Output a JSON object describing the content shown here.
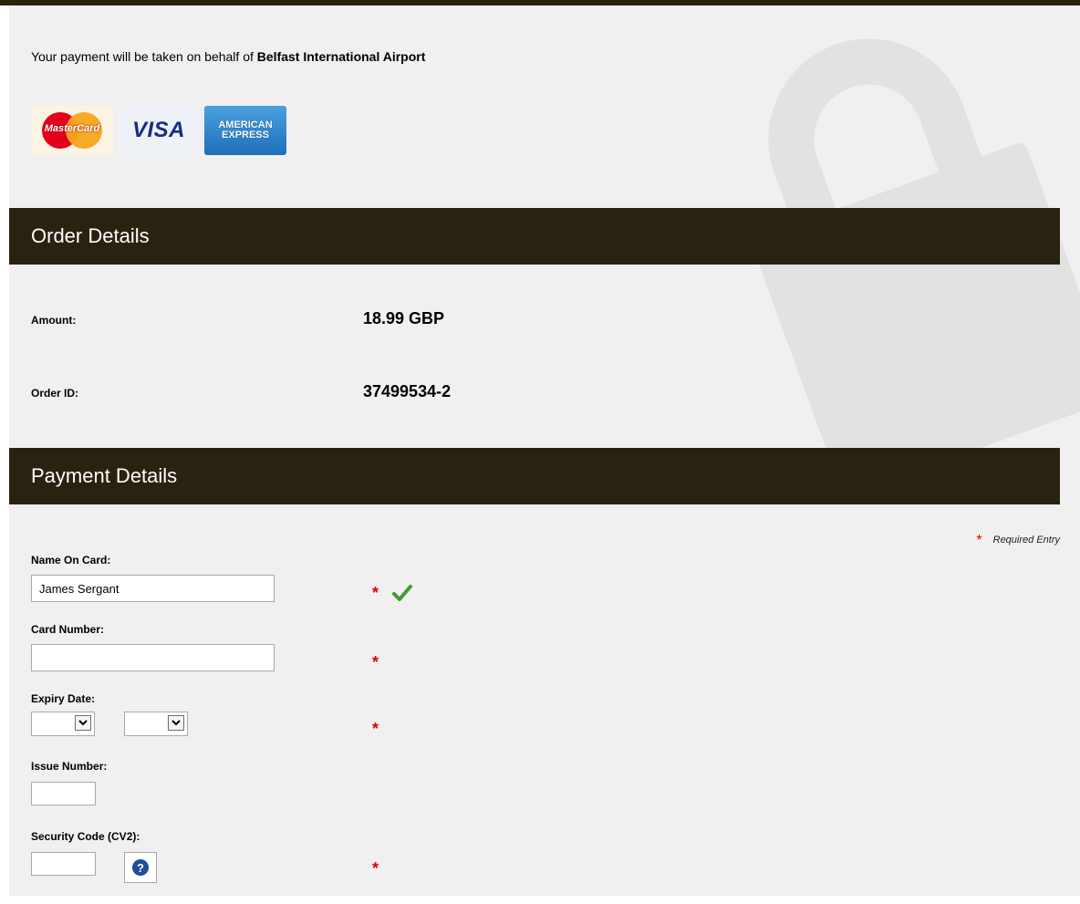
{
  "intro": {
    "prefix": "Your payment will be taken on behalf of ",
    "merchant": "Belfast International Airport"
  },
  "card_logos": [
    {
      "name": "mastercard-logo",
      "text": "MasterCard"
    },
    {
      "name": "visa-logo",
      "text": "VISA"
    },
    {
      "name": "amex-logo",
      "line1": "AMERICAN",
      "line2": "EXPRESS"
    }
  ],
  "order_details": {
    "heading": "Order Details",
    "amount_label": "Amount:",
    "amount_value": "18.99 GBP",
    "order_id_label": "Order ID:",
    "order_id_value": "37499534-2"
  },
  "payment_details": {
    "heading": "Payment Details",
    "required_star": "*",
    "required_note": "Required Entry",
    "name_label": "Name On Card:",
    "name_value": "James Sergant",
    "card_number_label": "Card Number:",
    "card_number_value": "",
    "expiry_label": "Expiry Date:",
    "expiry_month_value": "",
    "expiry_year_value": "",
    "issue_label": "Issue Number:",
    "issue_value": "",
    "cv2_label": "Security Code (CV2):",
    "cv2_value": "",
    "help_glyph": "?"
  },
  "icons": {
    "check": "check-icon",
    "help": "question-icon",
    "lock": "lock-icon",
    "dropdown": "chevron-down-icon"
  },
  "colors": {
    "header_bg": "#2a2210",
    "panel_bg": "#f0f0f0",
    "required": "#e00000",
    "check": "#3ca02c"
  }
}
